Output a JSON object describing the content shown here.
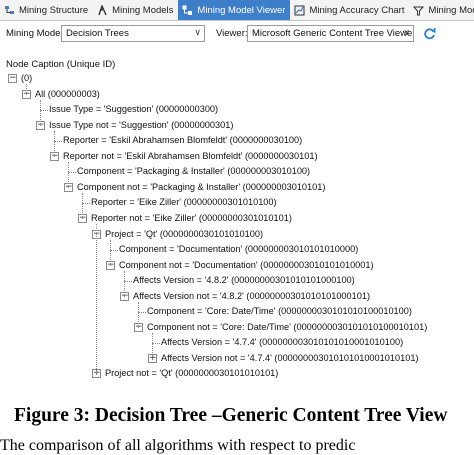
{
  "tabs": [
    {
      "label": "Mining Structure",
      "icon": "mining-structure-icon",
      "active": false
    },
    {
      "label": "Mining Models",
      "icon": "mining-models-icon",
      "active": false
    },
    {
      "label": "Mining Model Viewer",
      "icon": "mining-model-viewer-icon",
      "active": true
    },
    {
      "label": "Mining Accuracy Chart",
      "icon": "accuracy-chart-icon",
      "active": false
    },
    {
      "label": "Mining Model Prec",
      "icon": "prediction-icon",
      "active": false
    }
  ],
  "toolbar": {
    "model_label": "Mining Model:",
    "model_value": "Decision Trees",
    "viewer_label": "Viewer:",
    "viewer_value": "Microsoft Generic Content Tree Viewer"
  },
  "tree_caption": "Node Caption (Unique ID)",
  "tree": [
    {
      "text": "(0)",
      "level": 0,
      "toggle": "-"
    },
    {
      "text": "All (000000003)",
      "level": 1,
      "toggle": "-"
    },
    {
      "text": "Issue Type = 'Suggestion' (00000000300)",
      "level": 2,
      "toggle": ""
    },
    {
      "text": "Issue Type not = 'Suggestion' (00000000301)",
      "level": 2,
      "toggle": "-"
    },
    {
      "text": "Reporter = 'Eskil Abrahamsen Blomfeldt' (0000000030100)",
      "level": 3,
      "toggle": ""
    },
    {
      "text": "Reporter not = 'Eskil Abrahamsen Blomfeldt' (0000000030101)",
      "level": 3,
      "toggle": "-"
    },
    {
      "text": "Component = 'Packaging & Installer' (000000003010100)",
      "level": 4,
      "toggle": ""
    },
    {
      "text": "Component not = 'Packaging & Installer' (000000003010101)",
      "level": 4,
      "toggle": "-"
    },
    {
      "text": "Reporter = 'Eike Ziller' (00000000301010100)",
      "level": 5,
      "toggle": ""
    },
    {
      "text": "Reporter not = 'Eike Ziller' (00000000301010101)",
      "level": 5,
      "toggle": "-"
    },
    {
      "text": "Project = 'Qt' (0000000030101010100)",
      "level": 6,
      "toggle": "-"
    },
    {
      "text": "Component = 'Documentation' (000000003010101010000)",
      "level": 7,
      "toggle": ""
    },
    {
      "text": "Component not = 'Documentation' (000000003010101010001)",
      "level": 7,
      "toggle": "-"
    },
    {
      "text": "Affects Version = '4.8.2' (00000000301010101000100)",
      "level": 8,
      "toggle": ""
    },
    {
      "text": "Affects Version not = '4.8.2' (00000000301010101000101)",
      "level": 8,
      "toggle": "-"
    },
    {
      "text": "Component = 'Core: Date/Time' (0000000030101010100010100)",
      "level": 9,
      "toggle": ""
    },
    {
      "text": "Component not = 'Core: Date/Time' (0000000030101010100010101)",
      "level": 9,
      "toggle": "-"
    },
    {
      "text": "Affects Version = '4.7.4' (000000003010101010001010100)",
      "level": 10,
      "toggle": ""
    },
    {
      "text": "Affects Version not = '4.7.4' (000000003010101010001010101)",
      "level": 10,
      "toggle": "+"
    },
    {
      "text": "Project not = 'Qt' (0000000030101010101)",
      "level": 6,
      "toggle": "+"
    }
  ],
  "figure_caption": "Figure 3: Decision Tree –Generic Content Tree View",
  "body_text": "The comparison of all algorithms with respect to predic"
}
